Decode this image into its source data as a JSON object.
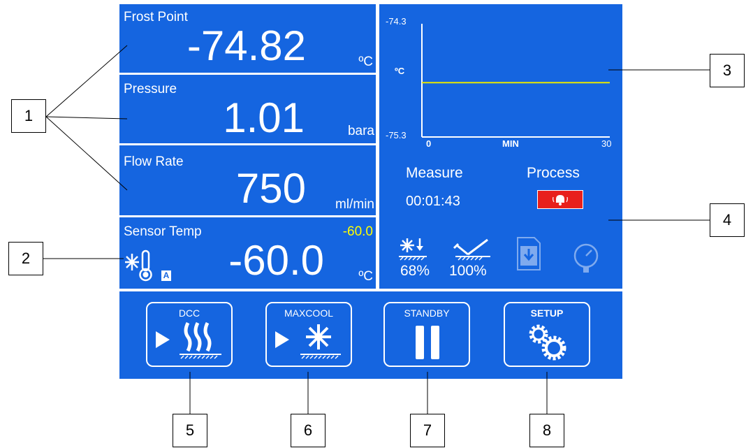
{
  "frost_point": {
    "label": "Frost Point",
    "value": "-74.82",
    "unit": "ºC"
  },
  "pressure": {
    "label": "Pressure",
    "value": "1.01",
    "unit": "bara"
  },
  "flow_rate": {
    "label": "Flow Rate",
    "value": "750",
    "unit": "ml/min"
  },
  "sensor_temp": {
    "label": "Sensor Temp",
    "setpoint": "-60.0",
    "value": "-60.0",
    "unit": "ºC",
    "badge": "A",
    "setpoint_color": "#ffff00"
  },
  "graph": {
    "ymax_label": "-74.3",
    "ymin_label": "-75.3",
    "yunit": "ºC",
    "xmin_label": "0",
    "xmax_label": "30",
    "xunit": "MIN",
    "line_color": "#e8e800"
  },
  "chart_data": {
    "type": "line",
    "x": [
      0,
      30
    ],
    "series": [
      {
        "values": [
          -74.82,
          -74.82
        ]
      }
    ],
    "xlabel": "MIN",
    "ylabel": "ºC",
    "xlim": [
      0,
      30
    ],
    "ylim": [
      -75.3,
      -74.3
    ]
  },
  "status": {
    "measure_label": "Measure",
    "measure_time": "00:01:43",
    "process_label": "Process",
    "alarm_icon": "alarm-bell-icon"
  },
  "indicators": {
    "cooling_pct": "68%",
    "mirror_pct": "100%"
  },
  "buttons": {
    "dcc": "DCC",
    "maxcool": "MAXCOOL",
    "standby": "STANDBY",
    "setup": "SETUP"
  },
  "callouts": [
    "1",
    "2",
    "3",
    "4",
    "5",
    "6",
    "7",
    "8"
  ],
  "colors": {
    "panel": "#1565e0",
    "alarm": "#e8201c",
    "yellow": "#ffff00"
  }
}
